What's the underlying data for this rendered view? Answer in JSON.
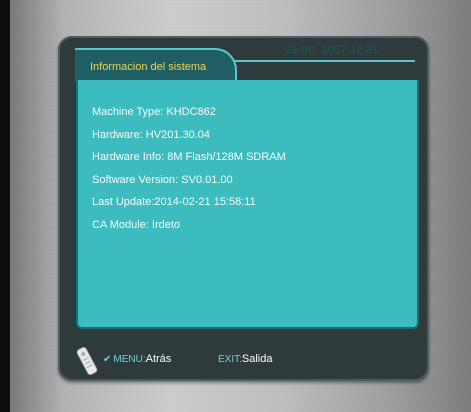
{
  "header": {
    "title": "Informacion del sistema",
    "time": "21:00",
    "date": "2007.12.31"
  },
  "info": {
    "lines": [
      "Machine Type: KHDC862",
      "Hardware: HV201.30.04",
      "Hardware Info: 8M Flash/128M SDRAM",
      "Software Version: SV0.01.00",
      "Last Update:2014-02-21 15:58:11",
      "CA Module: Irdeto"
    ]
  },
  "footer": {
    "remote_icon": "remote-control-icon",
    "menu_key": "MENU",
    "menu_action": "Atrás",
    "exit_key": "EXIT",
    "exit_action": "Salida"
  },
  "colors": {
    "accent_cyan": "#3dbcc0",
    "title_yellow": "#f2d44a",
    "panel_dark": "#2e3a3c"
  }
}
